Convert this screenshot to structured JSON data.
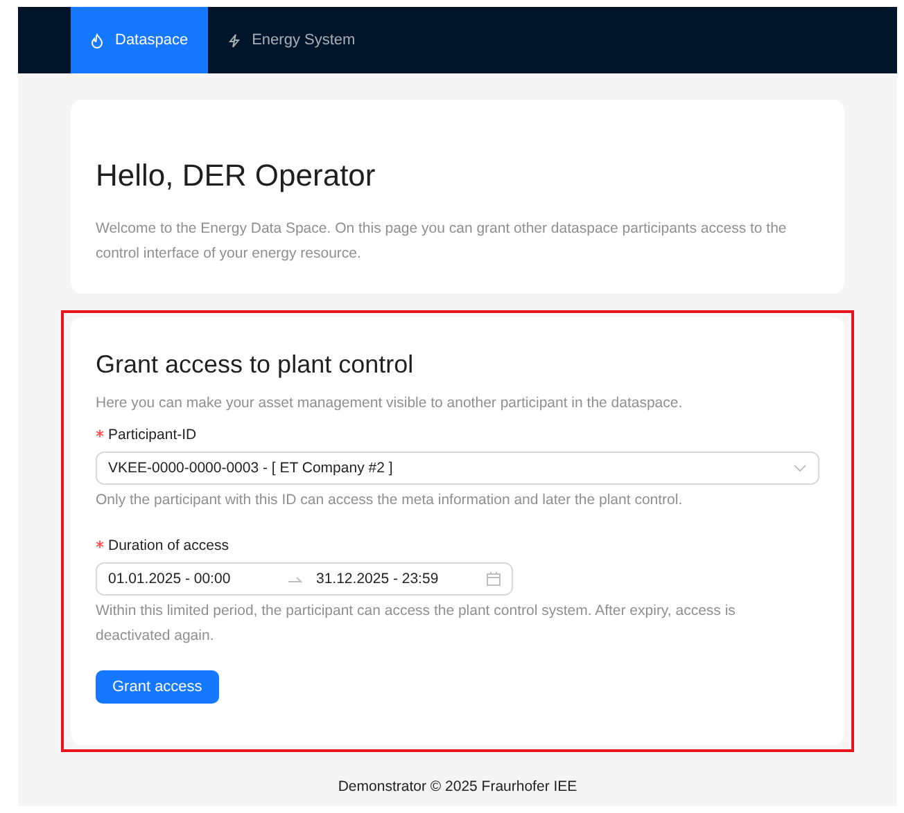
{
  "nav": {
    "tabs": [
      {
        "label": "Dataspace",
        "selected": true
      },
      {
        "label": "Energy System",
        "selected": false
      }
    ]
  },
  "welcome": {
    "title": "Hello, DER Operator",
    "text": "Welcome to the Energy Data Space. On this page you can grant other dataspace participants access to the control interface of your energy resource."
  },
  "grant": {
    "highlighted": true,
    "title": "Grant access to plant control",
    "intro": "Here you can make your asset management visible to another participant in the dataspace.",
    "fields": [
      {
        "kind": "select",
        "label": "Participant-ID",
        "required": true,
        "value": "VKEE-0000-0000-0003 - [ ET Company #2 ]",
        "help": "Only the participant with this ID can access the meta information and later the plant control."
      },
      {
        "kind": "range",
        "label": "Duration of access",
        "required": true,
        "start": "01.01.2025 - 00:00",
        "end": "31.12.2025 - 23:59",
        "help": "Within this limited period, the participant can access the plant control system. After expiry, access is deactivated again."
      }
    ],
    "button": "Grant access"
  },
  "footer": "Demonstrator © 2025 Fraurhofer IEE"
}
